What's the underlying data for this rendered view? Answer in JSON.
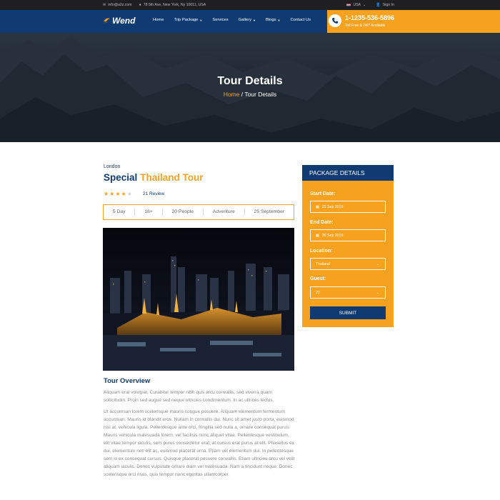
{
  "topbar": {
    "email": "info@a2z.com",
    "address": "78 5th Ave, New York, Ny 10011, USA",
    "country": "USA",
    "signin": "Sign In"
  },
  "nav": {
    "logo": "Wend",
    "items": [
      {
        "label": "Home",
        "dropdown": false
      },
      {
        "label": "Trip Package",
        "dropdown": true
      },
      {
        "label": "Services",
        "dropdown": false
      },
      {
        "label": "Gallery",
        "dropdown": true
      },
      {
        "label": "Blogs",
        "dropdown": true
      },
      {
        "label": "Contact Us",
        "dropdown": false
      }
    ],
    "phone": "1-1235-536-5896",
    "phone_sub": "Toll Free & 24/7 Available"
  },
  "hero": {
    "title": "Tour Details",
    "crumb_home": "Home",
    "crumb_sep": " / ",
    "crumb_current": "Tour Details"
  },
  "tour": {
    "location": "London",
    "title_main": "Special",
    "title_accent": "Thailand Tour",
    "rating": 4,
    "rating_max": 5,
    "review": "21 Review",
    "facts": [
      "5 Day",
      "18+",
      "20 People",
      "Adventure",
      "25 September"
    ]
  },
  "overview": {
    "heading": "Tour Overview",
    "p1": "Aliquam erat volutpat. Curabitur tempor nibh quis arcu convallis, sed viverra quam sollicitudin. Proin sed augue sed neque ultricies condimentum. In ac ultrices lectus.",
    "p2": "Ut accumsan lorem scelerisque mauris congue posuere. Aliquam elementum fermentum accumsan. Mauris id blandit eros. Nullam in convallis dui. Nunc sit amet justo porta, euismod nisi at, vehicula ligula. Pellentesque ante orci, fringilla sed nulla a, ornare consequat purus. Mauris vehicula malesuada lorem, vel facilisis nunc aliquet vitae. Pellentesque vestibulum, elit vitae tempor iaculis, sem purus consectetur erat, at cursus erat purus at elit. Phasellus ex dui, elementum nec elit ac, euismod placerat urna. Etiam vel elementum dui. In pellentesque sem in ex consequat cursus. Quisque placerat posuere convallis. Etiam ultricies arcu vel velit aliquam iaculis. Donec vulputate ornare diam vel malesuada. Nam a tincidunt neque. Donec scelerisque orci risus, quis tempor nunc egestas ullamcorper."
  },
  "package": {
    "heading": "PACKAGE DETAILS",
    "start_label": "Start Date:",
    "start_value": "25 Sep 2019",
    "end_label": "End Date:",
    "end_value": "30 Sep 2019",
    "location_label": "Location:",
    "location_value": "Thailand",
    "guest_label": "Guest:",
    "guest_value": "20",
    "submit": "SUBMIT"
  },
  "colors": {
    "navy": "#0f3a72",
    "orange": "#f6a21e"
  }
}
